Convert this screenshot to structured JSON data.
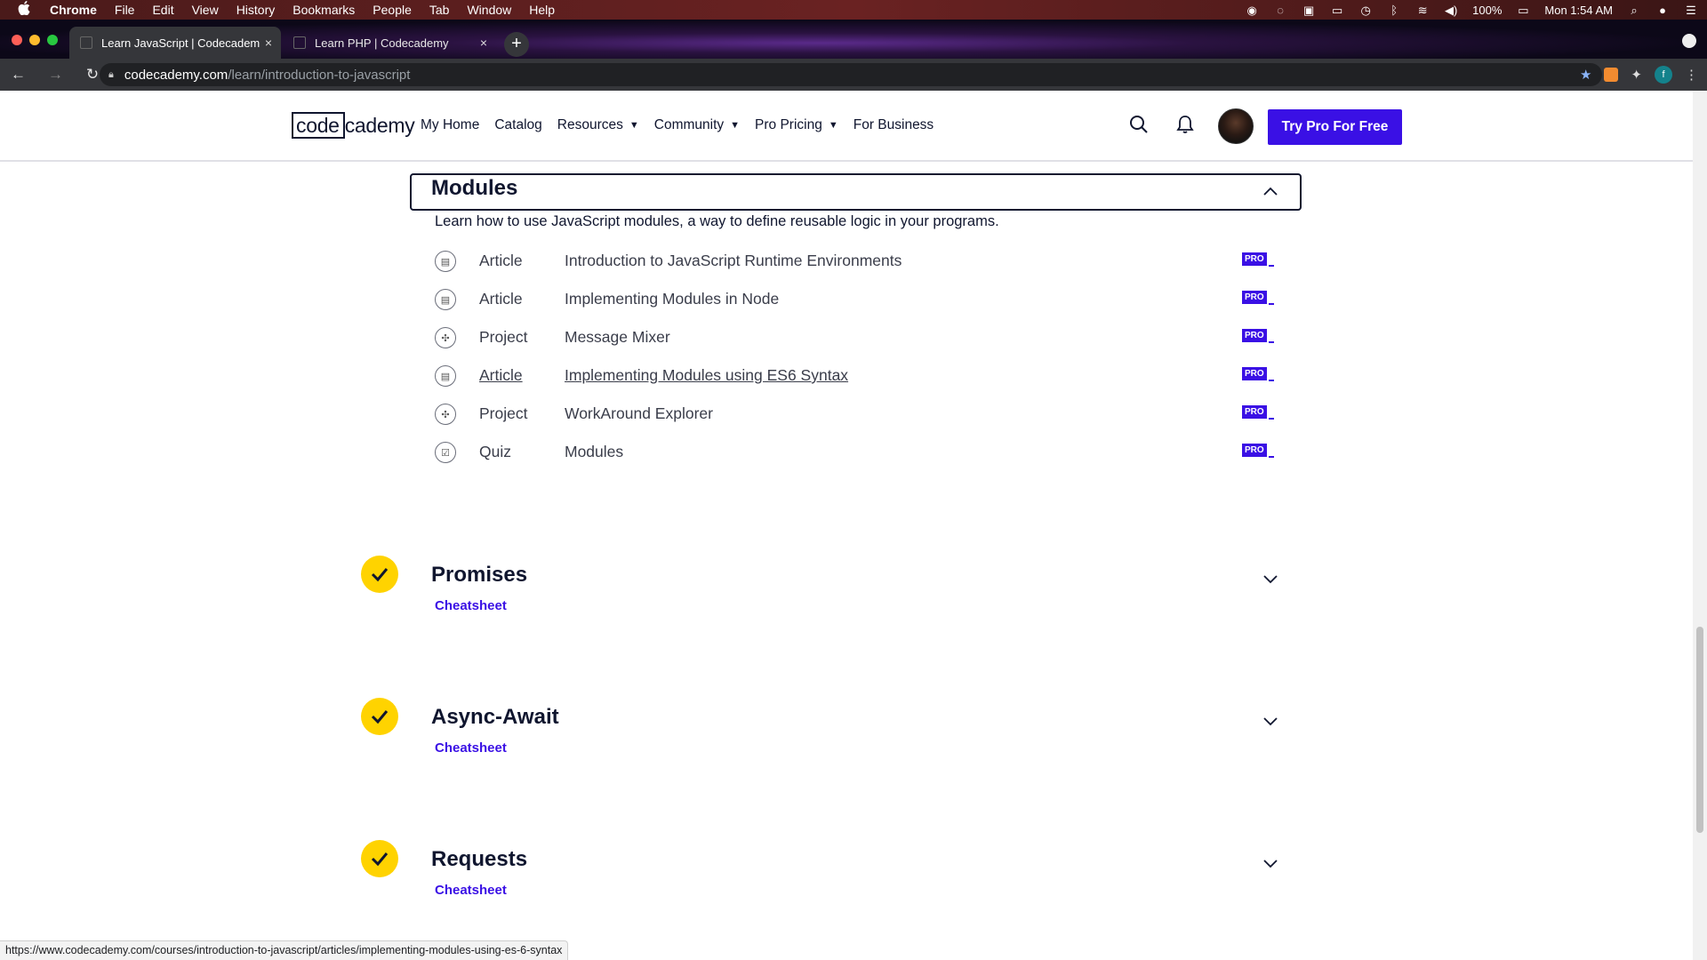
{
  "menubar": {
    "app": "Chrome",
    "items": [
      "File",
      "Edit",
      "View",
      "History",
      "Bookmarks",
      "People",
      "Tab",
      "Window",
      "Help"
    ],
    "battery": "100%",
    "clock": "Mon 1:54 AM"
  },
  "tabs": [
    {
      "title": "Learn JavaScript | Codecadem",
      "close": "×"
    },
    {
      "title": "Learn PHP | Codecademy",
      "close": "×"
    }
  ],
  "newtab": "+",
  "address": {
    "host": "codecademy.com",
    "path": "/learn/introduction-to-javascript"
  },
  "extensions": {
    "avatar_letter": "f"
  },
  "site": {
    "logo_box": "code",
    "logo_rest": "cademy",
    "nav": [
      {
        "label": "My Home",
        "dropdown": false
      },
      {
        "label": "Catalog",
        "dropdown": false
      },
      {
        "label": "Resources",
        "dropdown": true
      },
      {
        "label": "Community",
        "dropdown": true
      },
      {
        "label": "Pro Pricing",
        "dropdown": true
      },
      {
        "label": "For Business",
        "dropdown": false
      }
    ],
    "cta": "Try Pro For Free"
  },
  "module": {
    "title": "Modules",
    "description": "Learn how to use JavaScript modules, a way to define reusable logic in your programs.",
    "items": [
      {
        "type": "Article",
        "name": "Introduction to JavaScript Runtime Environments",
        "badge": "PRO",
        "icon": "article-icon"
      },
      {
        "type": "Article",
        "name": "Implementing Modules in Node",
        "badge": "PRO",
        "icon": "article-icon"
      },
      {
        "type": "Project",
        "name": "Message Mixer",
        "badge": "PRO",
        "icon": "project-icon"
      },
      {
        "type": "Article",
        "name": "Implementing Modules using ES6 Syntax",
        "badge": "PRO",
        "icon": "article-icon",
        "hovered": true
      },
      {
        "type": "Project",
        "name": "WorkAround Explorer",
        "badge": "PRO",
        "icon": "project-icon"
      },
      {
        "type": "Quiz",
        "name": "Modules",
        "badge": "PRO",
        "icon": "quiz-icon"
      }
    ]
  },
  "sections": [
    {
      "title": "Promises",
      "link": "Cheatsheet",
      "completed": true
    },
    {
      "title": "Async-Await",
      "link": "Cheatsheet",
      "completed": true
    },
    {
      "title": "Requests",
      "link": "Cheatsheet",
      "completed": true
    }
  ],
  "statusbar": "https://www.codecademy.com/courses/introduction-to-javascript/articles/implementing-modules-using-es-6-syntax",
  "colors": {
    "brand": "#3a10e5",
    "check": "#ffd300",
    "ink": "#10162f"
  }
}
